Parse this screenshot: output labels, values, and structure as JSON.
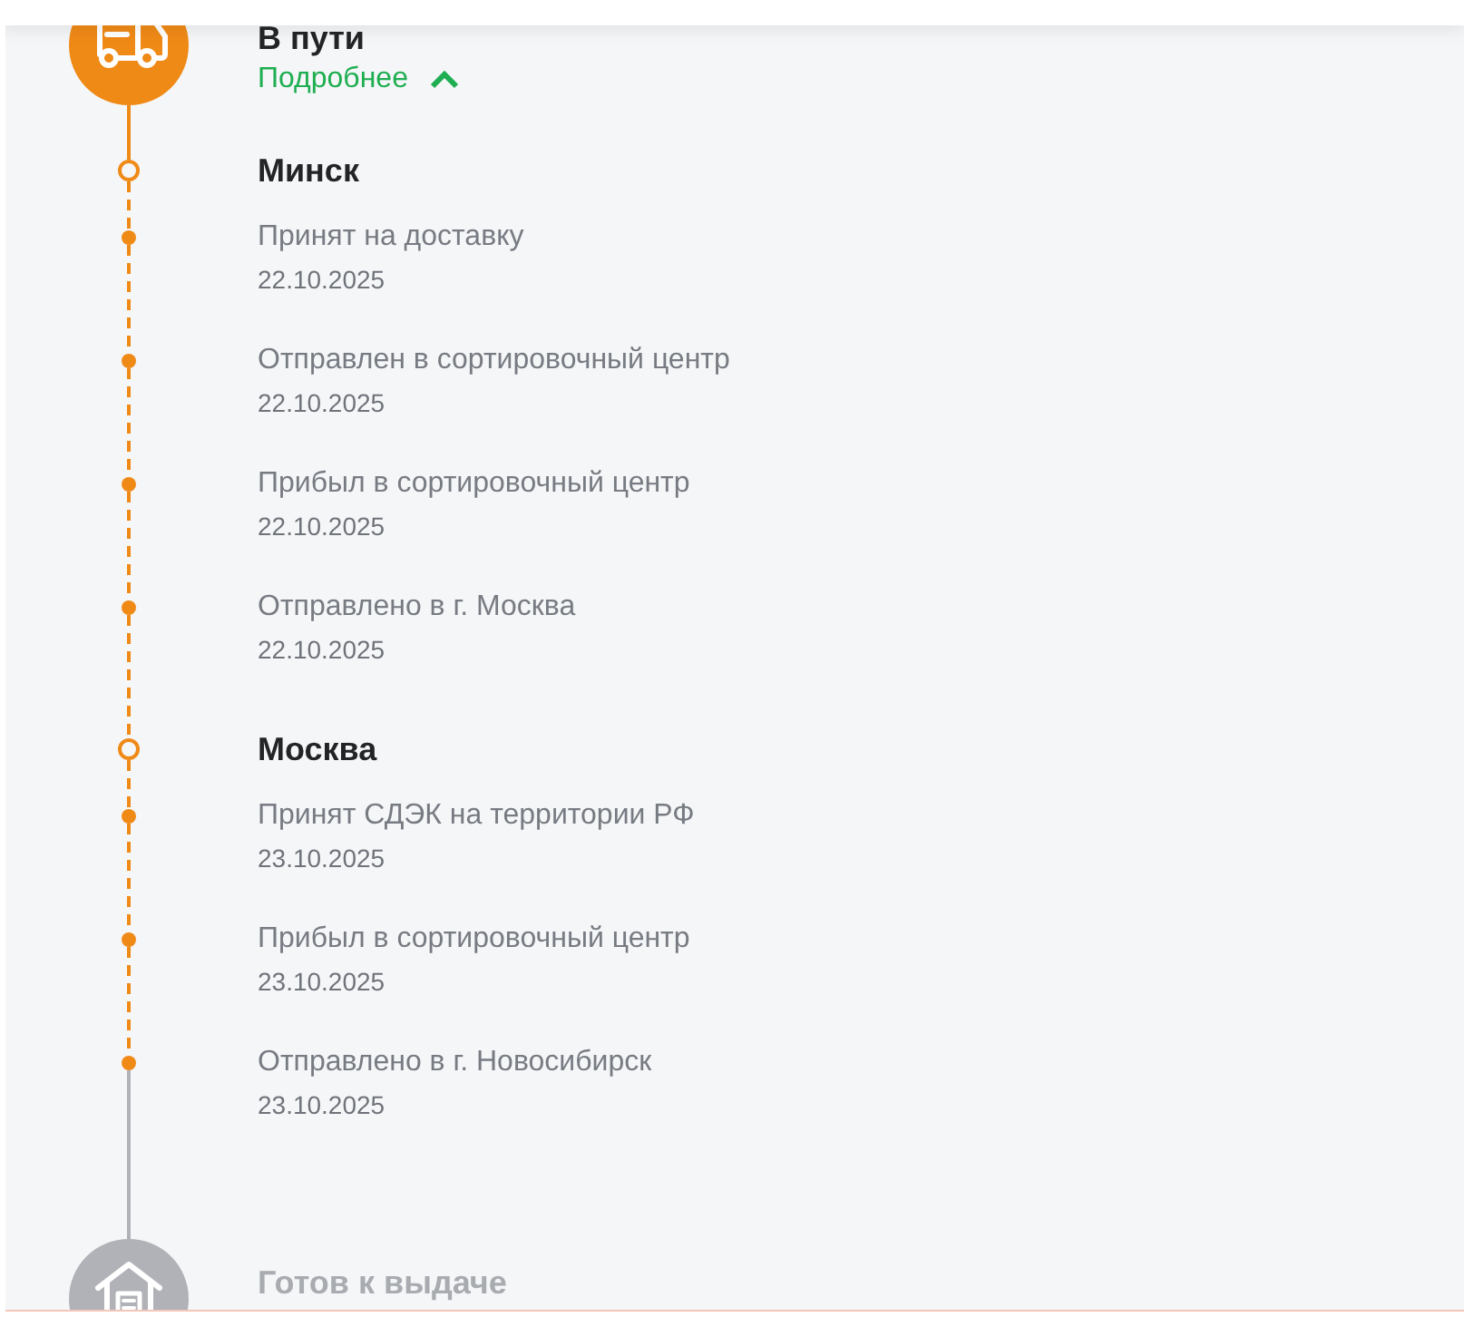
{
  "stages": [
    {
      "kind": "current",
      "title": "В пути",
      "details_link": {
        "label": "Подробнее",
        "expanded": true
      },
      "cities": [
        {
          "name": "Минск",
          "events": [
            {
              "text": "Принят на доставку",
              "date": "22.10.2025"
            },
            {
              "text": "Отправлен в сортировочный центр",
              "date": "22.10.2025"
            },
            {
              "text": "Прибыл в сортировочный центр",
              "date": "22.10.2025"
            },
            {
              "text": "Отправлено в г. Москва",
              "date": "22.10.2025"
            }
          ]
        },
        {
          "name": "Москва",
          "events": [
            {
              "text": "Принят СДЭК на территории РФ",
              "date": "23.10.2025"
            },
            {
              "text": "Прибыл в сортировочный центр",
              "date": "23.10.2025"
            },
            {
              "text": "Отправлено в г. Новосибирск",
              "date": "23.10.2025"
            }
          ]
        }
      ]
    },
    {
      "kind": "pending",
      "title": "Готов к выдаче"
    }
  ]
}
